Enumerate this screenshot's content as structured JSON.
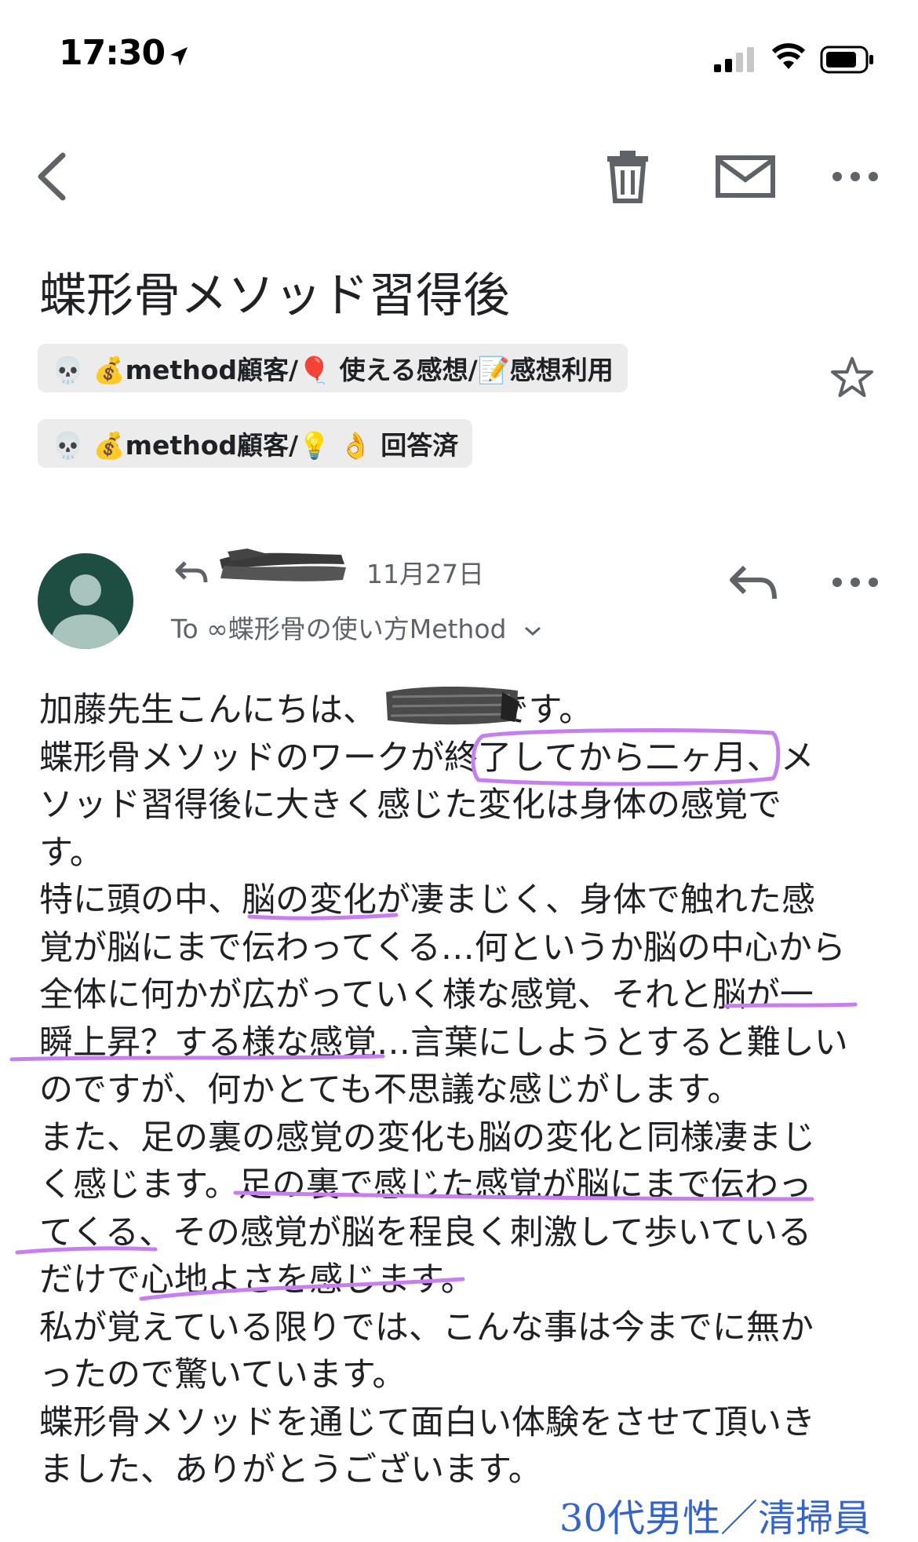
{
  "status_bar": {
    "time": "17:30"
  },
  "email": {
    "subject": "蝶形骨メソッド習得後",
    "labels": [
      "💀 💰method顧客/🎈 使える感想/📝感想利用",
      "💀 💰method顧客/💡 👌 回答済"
    ],
    "date": "11月27日",
    "to": "To ∞蝶形骨の使い方Method",
    "body_lines": [
      "加藤先生こんにちは、　　　　です。",
      "蝶形骨メソッドのワークが終了してから二ヶ月、メ",
      "ソッド習得後に大きく感じた変化は身体の感覚で",
      "す。",
      "特に頭の中、脳の変化が凄まじく、身体で触れた感",
      "覚が脳にまで伝わってくる…何というか脳の中心から",
      "全体に何かが広がっていく様な感覚、それと脳が一",
      "瞬上昇？する様な感覚…言葉にしようとすると難しい",
      "のですが、何かとても不思議な感じがします。",
      "また、足の裏の感覚の変化も脳の変化と同様凄まじ",
      "く感じます。足の裏で感じた感覚が脳にまで伝わっ",
      "てくる、その感覚が脳を程良く刺激して歩いている",
      "だけで心地よさを感じます。",
      "私が覚えている限りでは、こんな事は今までに無か",
      "ったので驚いています。",
      "蝶形骨メソッドを通じて面白い体験をさせて頂いき",
      "ました、ありがとうございます。"
    ],
    "signature": "30代男性／清掃員"
  },
  "colors": {
    "highlight": "#c77ff0",
    "avatar_bg": "#1e4e42",
    "signature": "#3564c9"
  }
}
